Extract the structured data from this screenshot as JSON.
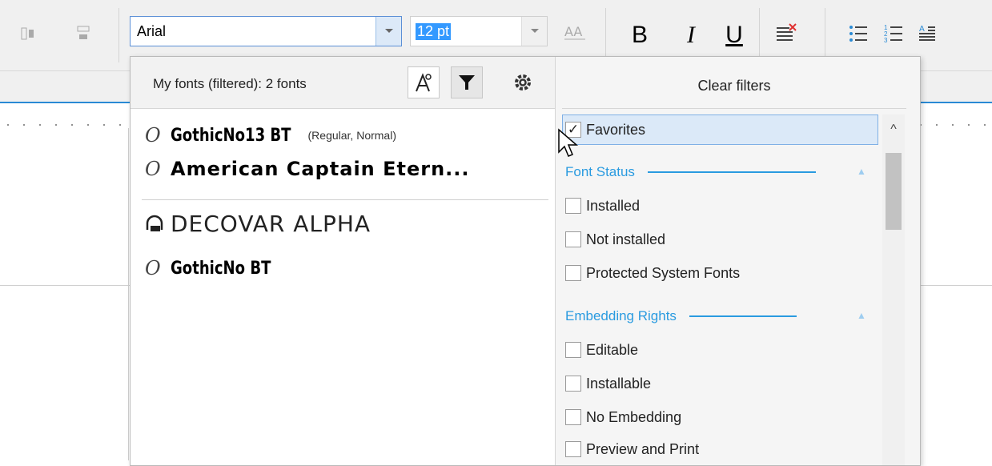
{
  "toolbar": {
    "font_name_value": "Arial",
    "font_size_value": "12 pt",
    "bold_label": "B",
    "italic_label": "I",
    "underline_label": "U",
    "icons": [
      "align-left-icon",
      "align-distribute-icon",
      "text-case-icon",
      "clear-formatting-icon",
      "bullet-list-icon",
      "numbered-list-icon",
      "paragraph-format-icon"
    ]
  },
  "font_list": {
    "header_label": "My fonts (filtered): 2 fonts",
    "items": [
      {
        "name": "GothicNo13 BT",
        "style": "(Regular, Normal)",
        "icon": "opentype-icon"
      },
      {
        "name": "American Captain Etern...",
        "style": "",
        "icon": "opentype-icon"
      },
      {
        "name": "DECOVAR ALPHA",
        "style": "",
        "icon": "variable-font-icon"
      },
      {
        "name": "GothicNo BT",
        "style": "",
        "icon": "opentype-icon"
      }
    ],
    "font_icon_glyph": "O"
  },
  "filters": {
    "clear_label": "Clear filters",
    "favorites": {
      "label": "Favorites",
      "checked": true
    },
    "sections": [
      {
        "title": "Font Status",
        "items": [
          {
            "label": "Installed",
            "checked": false
          },
          {
            "label": "Not installed",
            "checked": false
          },
          {
            "label": "Protected System Fonts",
            "checked": false
          }
        ]
      },
      {
        "title": "Embedding Rights",
        "items": [
          {
            "label": "Editable",
            "checked": false
          },
          {
            "label": "Installable",
            "checked": false
          },
          {
            "label": "No Embedding",
            "checked": false
          },
          {
            "label": "Preview and Print",
            "checked": false
          }
        ]
      }
    ]
  },
  "colors": {
    "accent": "#2a9be0",
    "selection": "#dbe9f8",
    "ruler_blue": "#2a8ad4"
  }
}
